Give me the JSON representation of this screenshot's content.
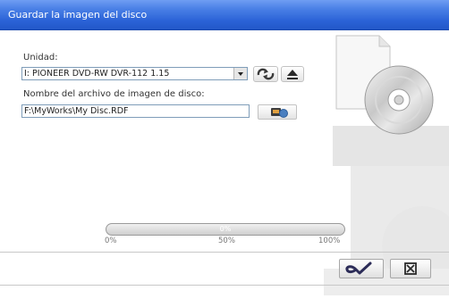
{
  "window": {
    "title": "Guardar la imagen del disco"
  },
  "drive": {
    "label": "Unidad:",
    "selected": "I: PIONEER DVD-RW  DVR-112 1.15"
  },
  "image_file": {
    "label": "Nombre del archivo de imagen de disco:",
    "value": "F:\\MyWorks\\My Disc.RDF"
  },
  "progress": {
    "percent": 0,
    "text": "0%",
    "scale": [
      "0%",
      "50%",
      "100%"
    ]
  },
  "icons": {
    "refresh": "refresh-icon",
    "eject": "eject-icon",
    "browse": "browse-icon",
    "ok": "ok-checkmark-icon",
    "cancel": "cancel-icon",
    "disc_image": "disc-image-icon"
  },
  "colors": {
    "titlebar": "#2b63d7",
    "title_text": "#ffffff",
    "progress_fill": "#3e87d8",
    "ok_icon": "#2c2c58"
  }
}
